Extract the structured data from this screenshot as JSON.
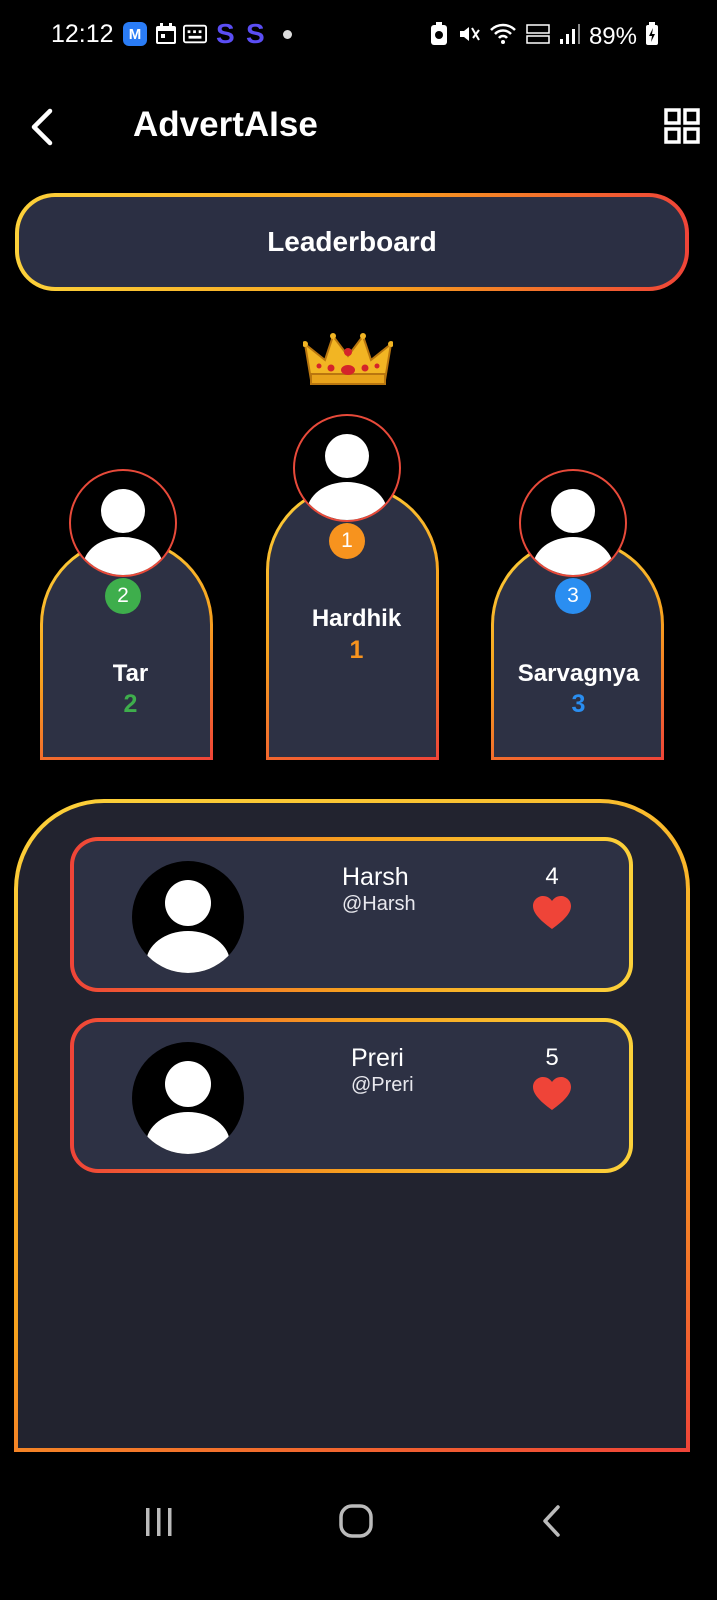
{
  "status_bar": {
    "time": "12:12",
    "app_icons": [
      "m-app-icon",
      "calendar-icon",
      "keyboard-icon",
      "s-app-icon",
      "s-app-icon"
    ],
    "m_icon_text": "M",
    "s1_text": "S",
    "s2_text": "S",
    "battery": "89%"
  },
  "header": {
    "title": "AdvertAIse"
  },
  "leaderboard_button": {
    "label": "Leaderboard"
  },
  "podium": {
    "first": {
      "rank": "1",
      "name": "Hardhik",
      "score": "1",
      "color": "#f7931e"
    },
    "second": {
      "rank": "2",
      "name": "Tar",
      "score": "2",
      "color": "#3eae4c"
    },
    "third": {
      "rank": "3",
      "name": "Sarvagnya",
      "score": "3",
      "color": "#2a8ef1"
    }
  },
  "list": [
    {
      "name": "Harsh",
      "handle": "@Harsh",
      "score": "4"
    },
    {
      "name": "Preri",
      "handle": "@Preri",
      "score": "5"
    }
  ],
  "colors": {
    "background": "#000000",
    "card": "#2d3144",
    "panel": "#22232f",
    "gradient_yellow": "#fcd13a",
    "gradient_orange": "#f7a11e",
    "gradient_red": "#ef4438",
    "heart": "#ef4438"
  }
}
